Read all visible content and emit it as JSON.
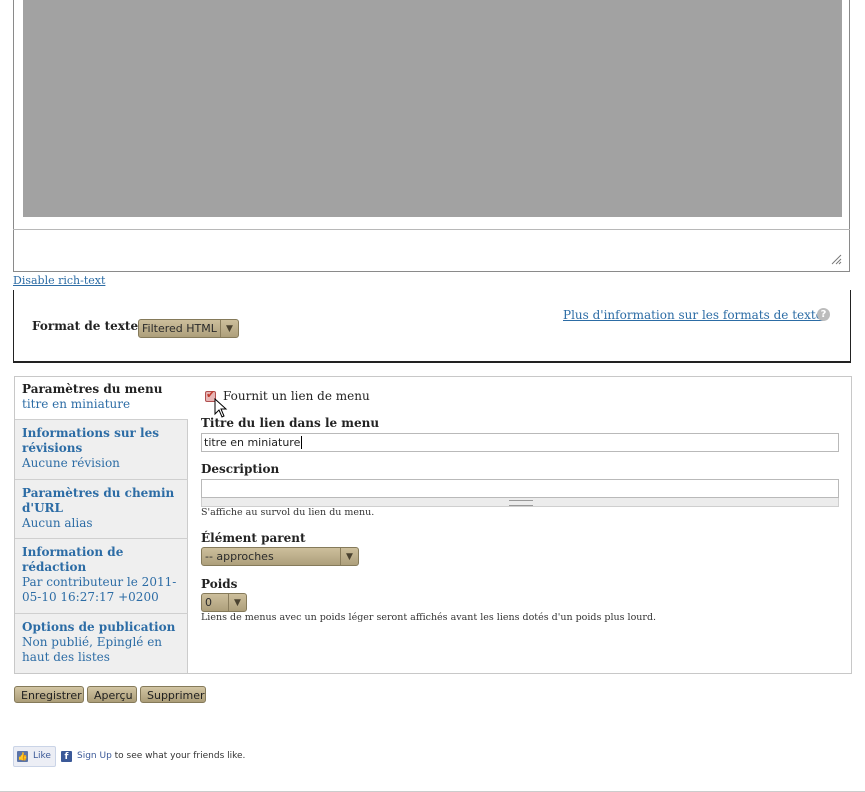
{
  "editor": {
    "disable_rich_text": "Disable rich-text"
  },
  "text_format": {
    "label": "Format de texte",
    "selected": "Filtered HTML",
    "more_info": "Plus d'information sur les formats de texte",
    "help_icon": "question-icon"
  },
  "vertical_tabs": [
    {
      "title": "Paramètres du menu",
      "summary": "titre en miniature"
    },
    {
      "title": "Informations sur les révisions",
      "summary": "Aucune révision"
    },
    {
      "title": "Paramètres du chemin d'URL",
      "summary": "Aucun alias"
    },
    {
      "title": "Information de rédaction",
      "summary": "Par contributeur le 2011-05-10 16:27:17 +0200"
    },
    {
      "title": "Options de publication",
      "summary": "Non publié, Epinglé en haut des listes"
    }
  ],
  "menu_settings": {
    "provide_link_label": "Fournit un lien de menu",
    "provide_link_checked": true,
    "link_title_label": "Titre du lien dans le menu",
    "link_title_value": "titre en miniature",
    "description_label": "Description",
    "description_value": "",
    "description_hint": "S'affiche au survol du lien du menu.",
    "parent_label": "Élément parent",
    "parent_value": "-- approches",
    "weight_label": "Poids",
    "weight_value": "0",
    "weight_hint": "Liens de menus avec un poids léger seront affichés avant les liens dotés d'un poids plus lourd."
  },
  "actions": {
    "save": "Enregistrer",
    "preview": "Aperçu",
    "delete": "Supprimer"
  },
  "facebook": {
    "like": "Like",
    "sign_up": "Sign Up",
    "suffix": " to see what your friends like."
  }
}
